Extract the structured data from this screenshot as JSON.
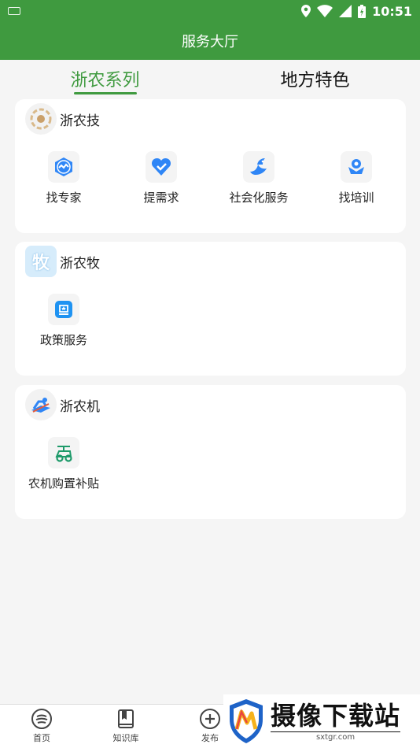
{
  "status_bar": {
    "time": "10:51"
  },
  "header": {
    "title": "服务大厅"
  },
  "tabs": [
    {
      "label": "浙农系列",
      "active": true
    },
    {
      "label": "地方特色",
      "active": false
    }
  ],
  "sections": [
    {
      "title": "浙农技",
      "items": [
        {
          "label": "找专家",
          "icon": "expert-icon"
        },
        {
          "label": "提需求",
          "icon": "heart-check-icon"
        },
        {
          "label": "社会化服务",
          "icon": "bird-icon"
        },
        {
          "label": "找培训",
          "icon": "training-icon"
        }
      ]
    },
    {
      "title": "浙农牧",
      "logo_char": "牧",
      "items": [
        {
          "label": "政策服务",
          "icon": "policy-icon"
        }
      ]
    },
    {
      "title": "浙农机",
      "items": [
        {
          "label": "农机购置补贴",
          "icon": "tractor-icon"
        }
      ]
    }
  ],
  "bottom_nav": [
    {
      "label": "首页",
      "icon": "home-icon"
    },
    {
      "label": "知识库",
      "icon": "book-icon"
    },
    {
      "label": "发布",
      "icon": "plus-circle-icon"
    }
  ],
  "watermark": {
    "title": "摄像下载站",
    "url": "sxtgr.com"
  },
  "colors": {
    "primary": "#3f9a3f",
    "icon_blue": "#2f86f6",
    "icon_green": "#1e9a6a"
  }
}
